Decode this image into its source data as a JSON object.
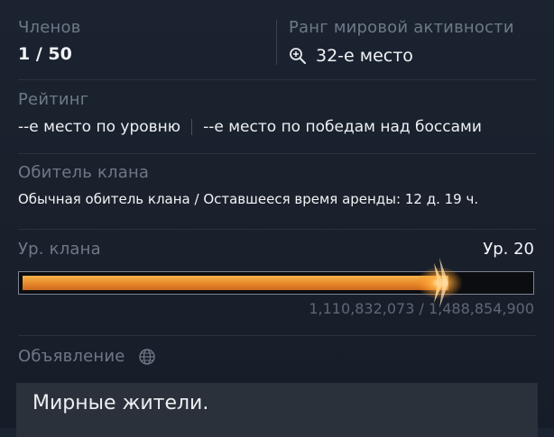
{
  "members": {
    "label": "Членов",
    "value": "1 / 50"
  },
  "world_rank": {
    "label": "Ранг мировой активности",
    "value": "32-е место",
    "icon": "zoom-in-icon"
  },
  "rating": {
    "label": "Рейтинг",
    "by_level": "--е место по уровню",
    "by_bosses": "--е место по победам над боссами"
  },
  "residence": {
    "label": "Обитель клана",
    "value": "Обычная обитель клана / Оставшееся время аренды: 12 д. 19 ч."
  },
  "clan_level": {
    "label": "Ур. клана",
    "value": "Ур. 20",
    "progress": 0.84,
    "xp_text": "1,110,832,073 / 1,488,854,900",
    "bar_color": "#e8892a"
  },
  "announcement": {
    "label": "Объявление",
    "icon": "globe-icon",
    "text": "Мирные жители."
  }
}
